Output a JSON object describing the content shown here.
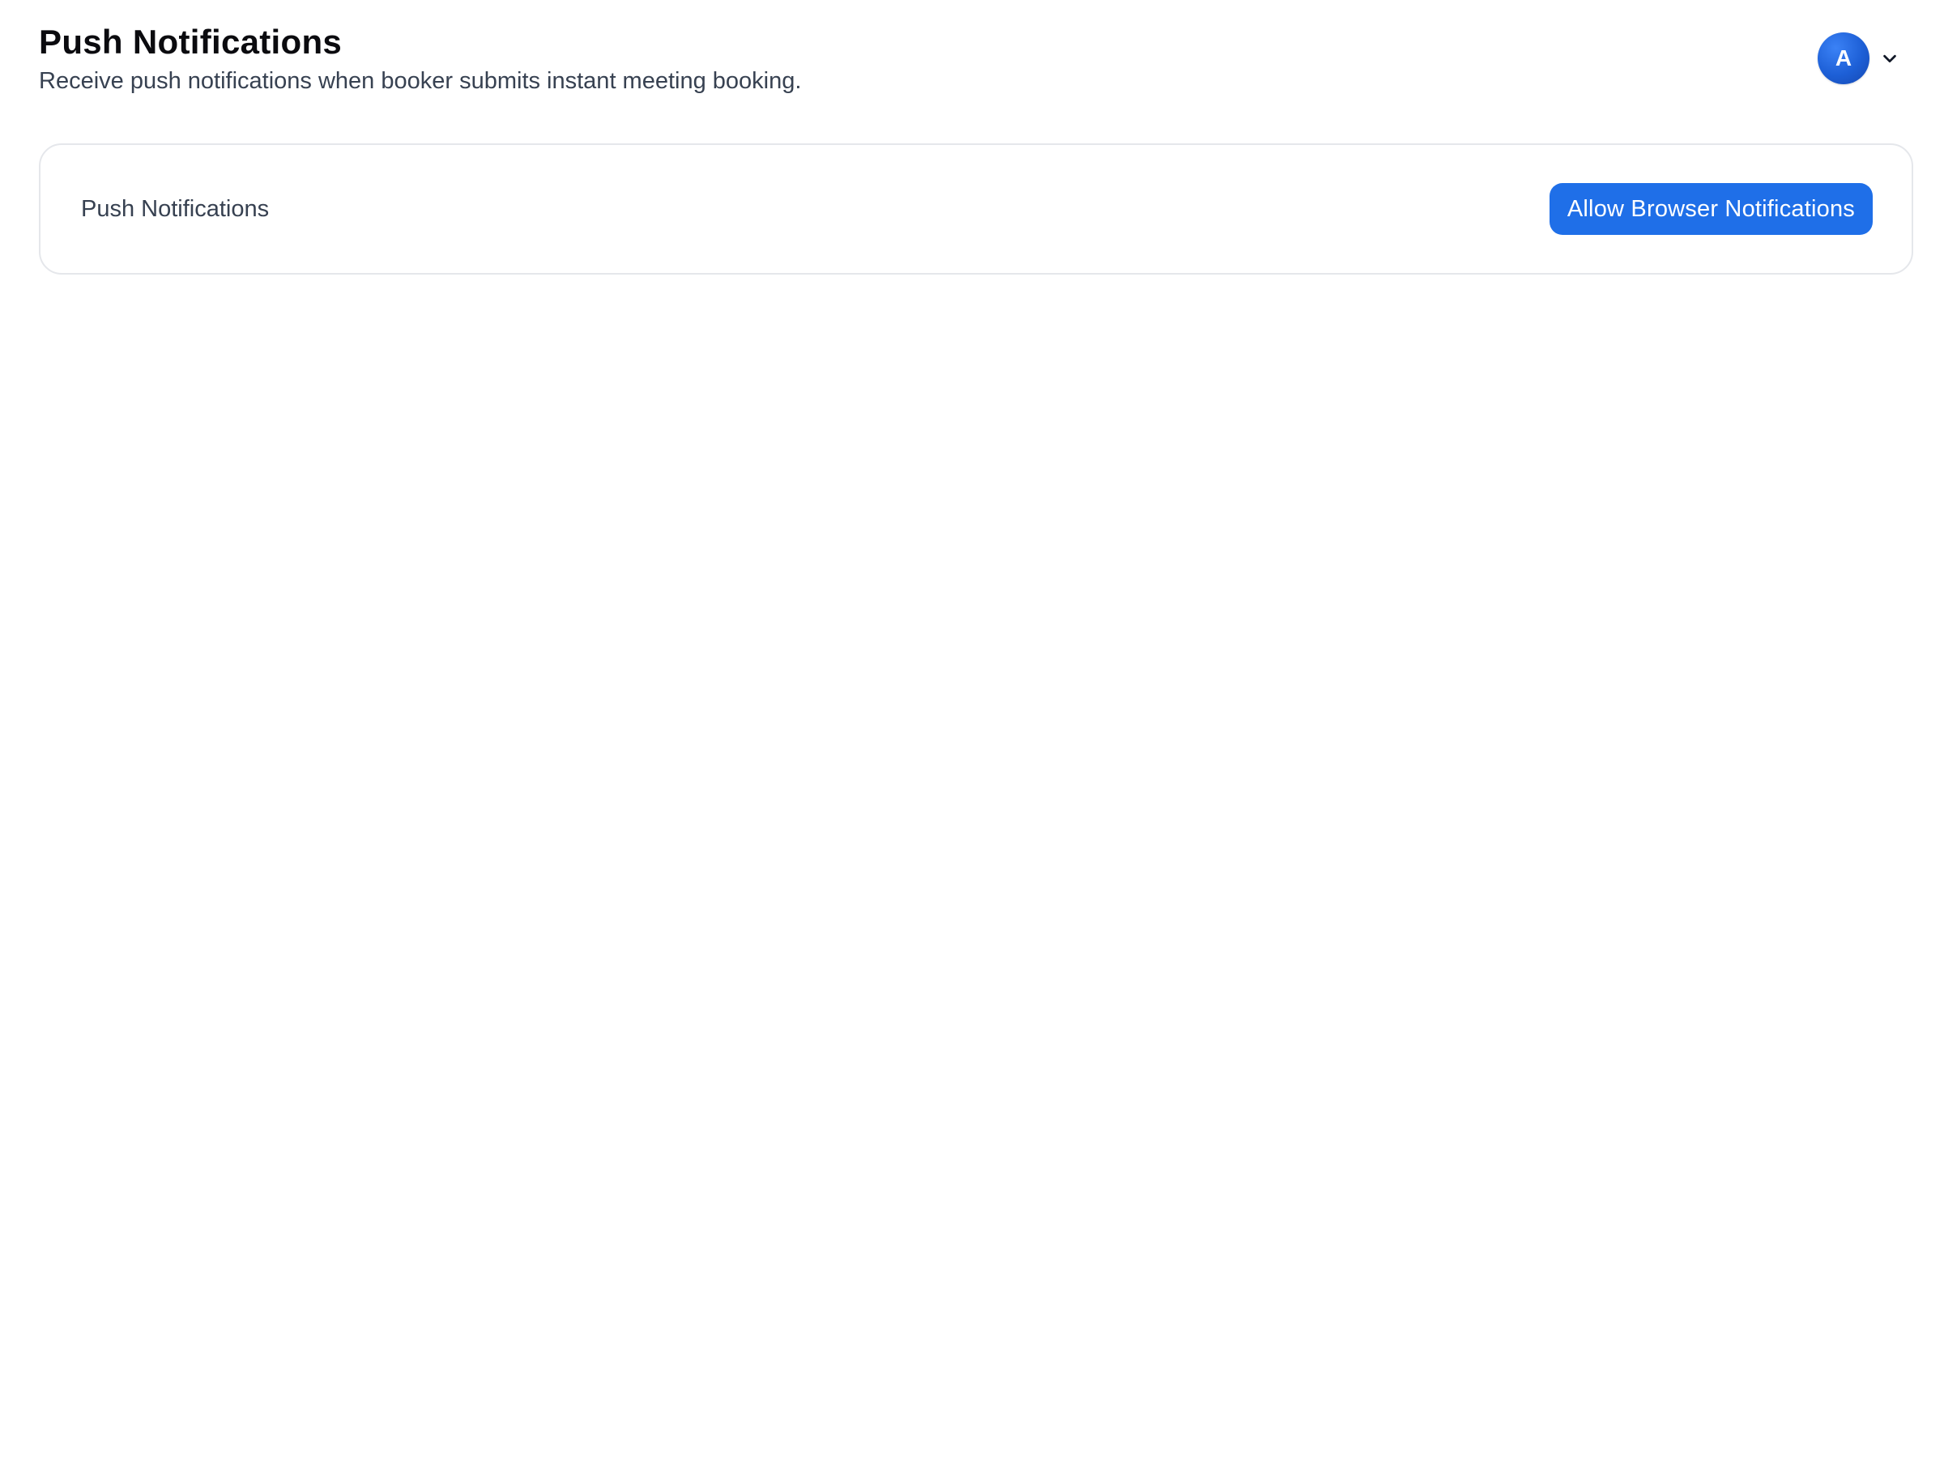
{
  "header": {
    "title": "Push Notifications",
    "subtitle": "Receive push notifications when booker submits instant meeting booking."
  },
  "user_menu": {
    "avatar_initial": "A",
    "chevron_icon": "chevron-down-icon",
    "avatar_color": "#1d5fd6"
  },
  "card": {
    "label": "Push Notifications",
    "button_label": "Allow Browser Notifications",
    "button_color": "#1f6fe8"
  }
}
